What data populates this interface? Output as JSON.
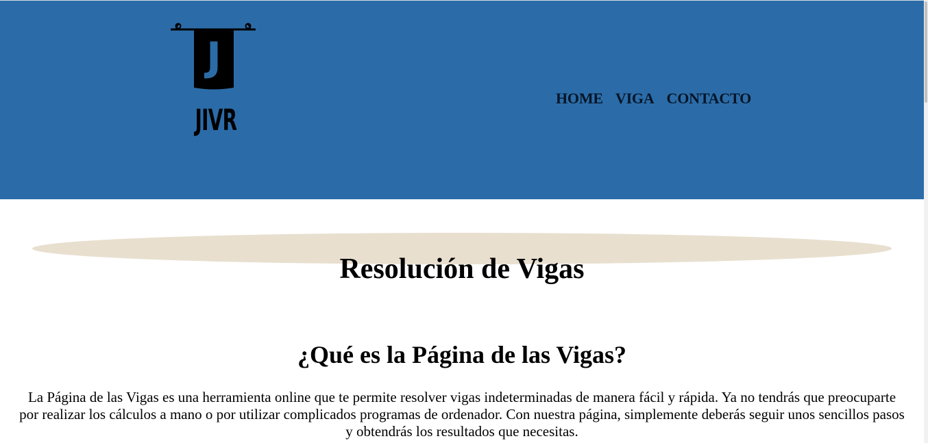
{
  "header": {
    "logo_text": "JIVR",
    "logo_letter": "J",
    "colors": {
      "background": "#2b6ca8",
      "logo": "#000000",
      "nav_text": "#061527"
    }
  },
  "nav": {
    "items": [
      {
        "label": "HOME"
      },
      {
        "label": "VIGA"
      },
      {
        "label": "CONTACTO"
      }
    ]
  },
  "main": {
    "title": "Resolución de Vigas",
    "title_band_color": "#e8dfcf",
    "section_title": "¿Qué es la Página de las Vigas?",
    "description": "La Página de las Vigas es una herramienta online que te permite resolver vigas indeterminadas de manera fácil y rápida. Ya no tendrás que preocuparte por realizar los cálculos a mano o por utilizar complicados programas de ordenador. Con nuestra página, simplemente deberás seguir unos sencillos pasos y obtendrás los resultados que necesitas."
  }
}
